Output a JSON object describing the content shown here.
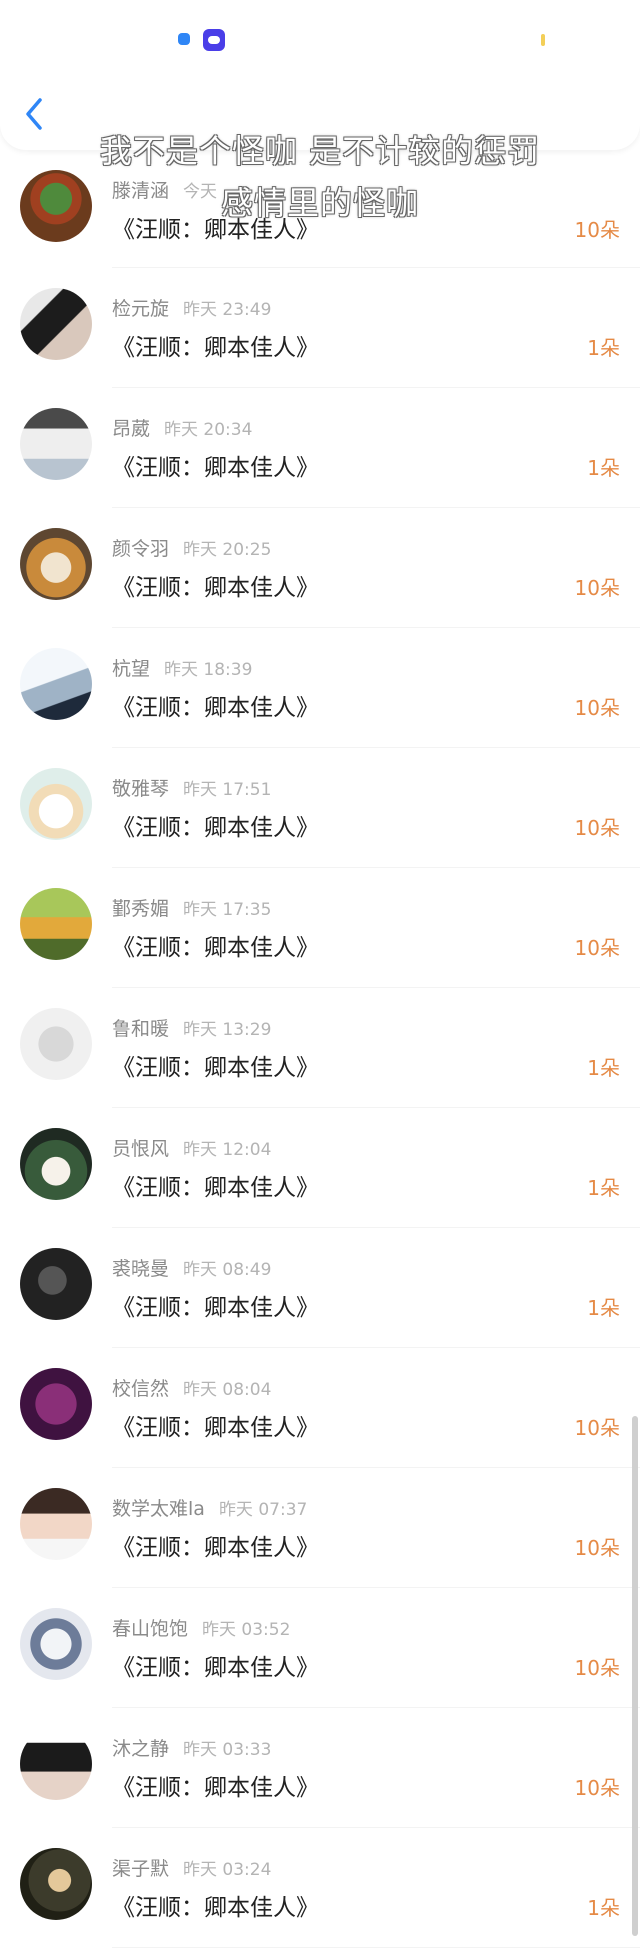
{
  "header": {
    "back_icon": "chevron-left-icon",
    "accent": "#2f86f6",
    "overlay_line1": "我不是个怪咖 是不计较的惩罚",
    "overlay_line2": "感情里的怪咖"
  },
  "colors": {
    "amount": "#e58a46",
    "name": "#8a8a8a",
    "time": "#b4b4b4",
    "title": "#222222"
  },
  "list": {
    "items": [
      {
        "name": "滕清涵",
        "time": "今天",
        "title": "《汪顺：卿本佳人》",
        "amount": "10朵"
      },
      {
        "name": "检元旋",
        "time": "昨天 23:49",
        "title": "《汪顺：卿本佳人》",
        "amount": "1朵"
      },
      {
        "name": "昂葳",
        "time": "昨天 20:34",
        "title": "《汪顺：卿本佳人》",
        "amount": "1朵"
      },
      {
        "name": "颜令羽",
        "time": "昨天 20:25",
        "title": "《汪顺：卿本佳人》",
        "amount": "10朵"
      },
      {
        "name": "杭望",
        "time": "昨天 18:39",
        "title": "《汪顺：卿本佳人》",
        "amount": "10朵"
      },
      {
        "name": "敬雅琴",
        "time": "昨天 17:51",
        "title": "《汪顺：卿本佳人》",
        "amount": "10朵"
      },
      {
        "name": "鄞秀媚",
        "time": "昨天 17:35",
        "title": "《汪顺：卿本佳人》",
        "amount": "10朵"
      },
      {
        "name": "鲁和暖",
        "time": "昨天 13:29",
        "title": "《汪顺：卿本佳人》",
        "amount": "1朵"
      },
      {
        "name": "员恨风",
        "time": "昨天 12:04",
        "title": "《汪顺：卿本佳人》",
        "amount": "1朵"
      },
      {
        "name": "裘晓曼",
        "time": "昨天 08:49",
        "title": "《汪顺：卿本佳人》",
        "amount": "1朵"
      },
      {
        "name": "校信然",
        "time": "昨天 08:04",
        "title": "《汪顺：卿本佳人》",
        "amount": "10朵"
      },
      {
        "name": "数学太难la",
        "time": "昨天 07:37",
        "title": "《汪顺：卿本佳人》",
        "amount": "10朵"
      },
      {
        "name": "春山饱饱",
        "time": "昨天 03:52",
        "title": "《汪顺：卿本佳人》",
        "amount": "10朵"
      },
      {
        "name": "沐之静",
        "time": "昨天 03:33",
        "title": "《汪顺：卿本佳人》",
        "amount": "10朵"
      },
      {
        "name": "渠子默",
        "time": "昨天 03:24",
        "title": "《汪顺：卿本佳人》",
        "amount": "1朵"
      }
    ]
  }
}
